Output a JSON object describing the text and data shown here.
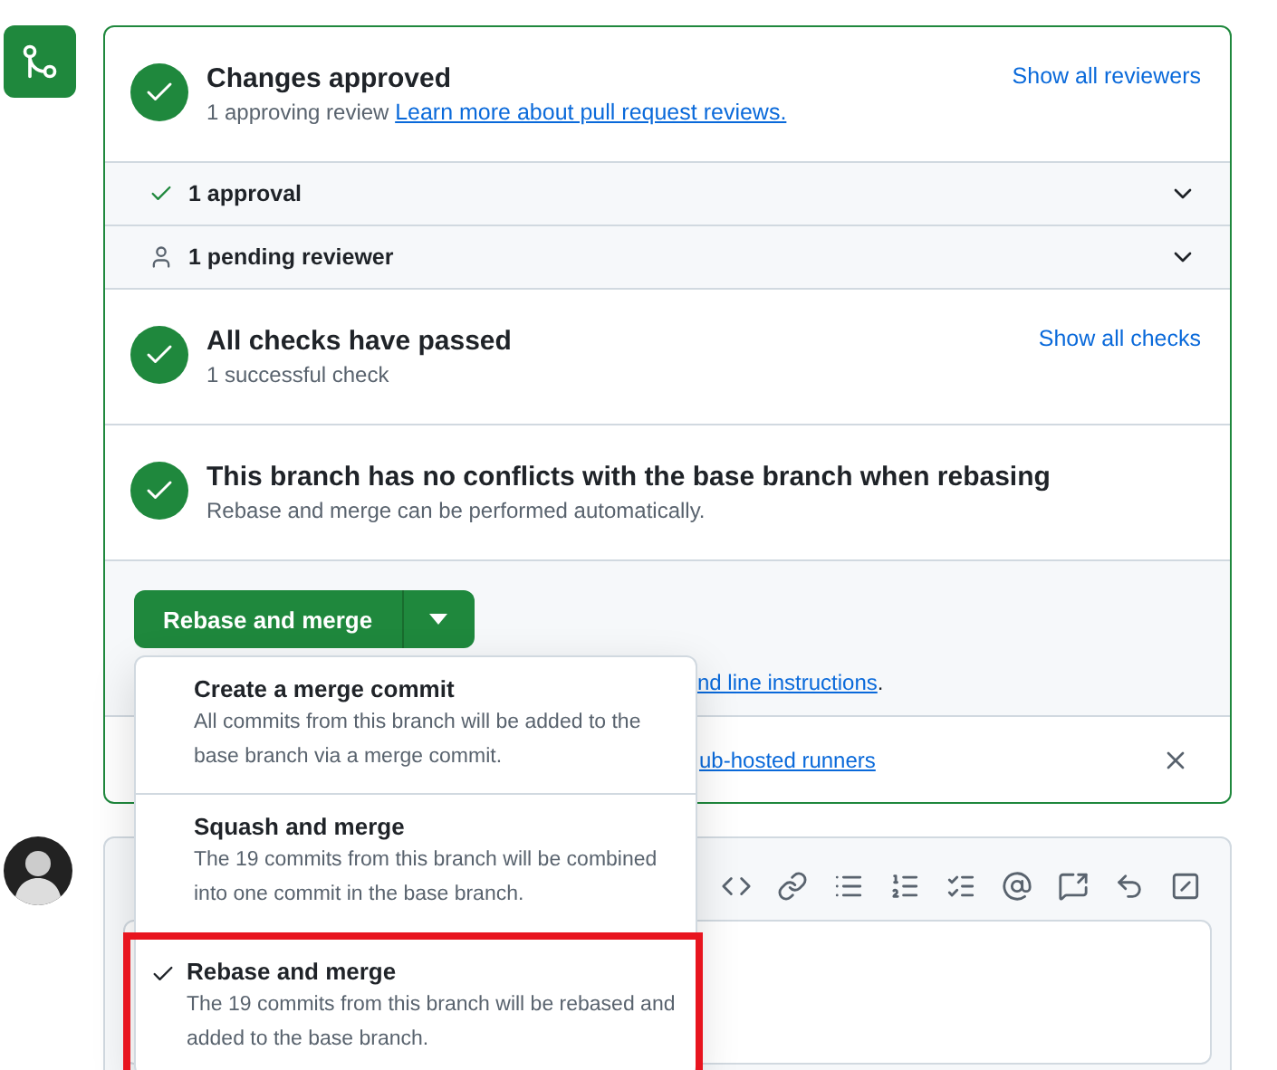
{
  "status_sections": [
    {
      "kind": "status",
      "title": "Changes approved",
      "subtitle": "1 approving review",
      "link": "Learn more about pull request reviews.",
      "action": "Show all reviewers"
    },
    {
      "kind": "approval_row",
      "label": "1 approval",
      "expanded": false
    },
    {
      "kind": "pending_row",
      "label": "1 pending reviewer",
      "expanded": false
    },
    {
      "kind": "status",
      "title": "All checks have passed",
      "subtitle": "1 successful check",
      "action": "Show all checks"
    },
    {
      "kind": "status",
      "title": "This branch has no conflicts with the base branch when rebasing",
      "subtitle": "Rebase and merge can be performed automatically."
    }
  ],
  "merge": {
    "button": "Rebase and merge",
    "hint_link": "nd line instructions",
    "hint_tail": ".",
    "notice_link": "ub-hosted runners"
  },
  "merge_menu": [
    {
      "title": "Create a merge commit",
      "description": "All commits from this branch will be added to the base branch via a merge commit.",
      "selected": false,
      "highlighted": false
    },
    {
      "title": "Squash and merge",
      "description": "The 19 commits from this branch will be combined into one commit in the base branch.",
      "selected": false,
      "highlighted": false
    },
    {
      "title": "Rebase and merge",
      "description": "The 19 commits from this branch will be rebased and added to the base branch.",
      "selected": true,
      "highlighted": true
    }
  ]
}
